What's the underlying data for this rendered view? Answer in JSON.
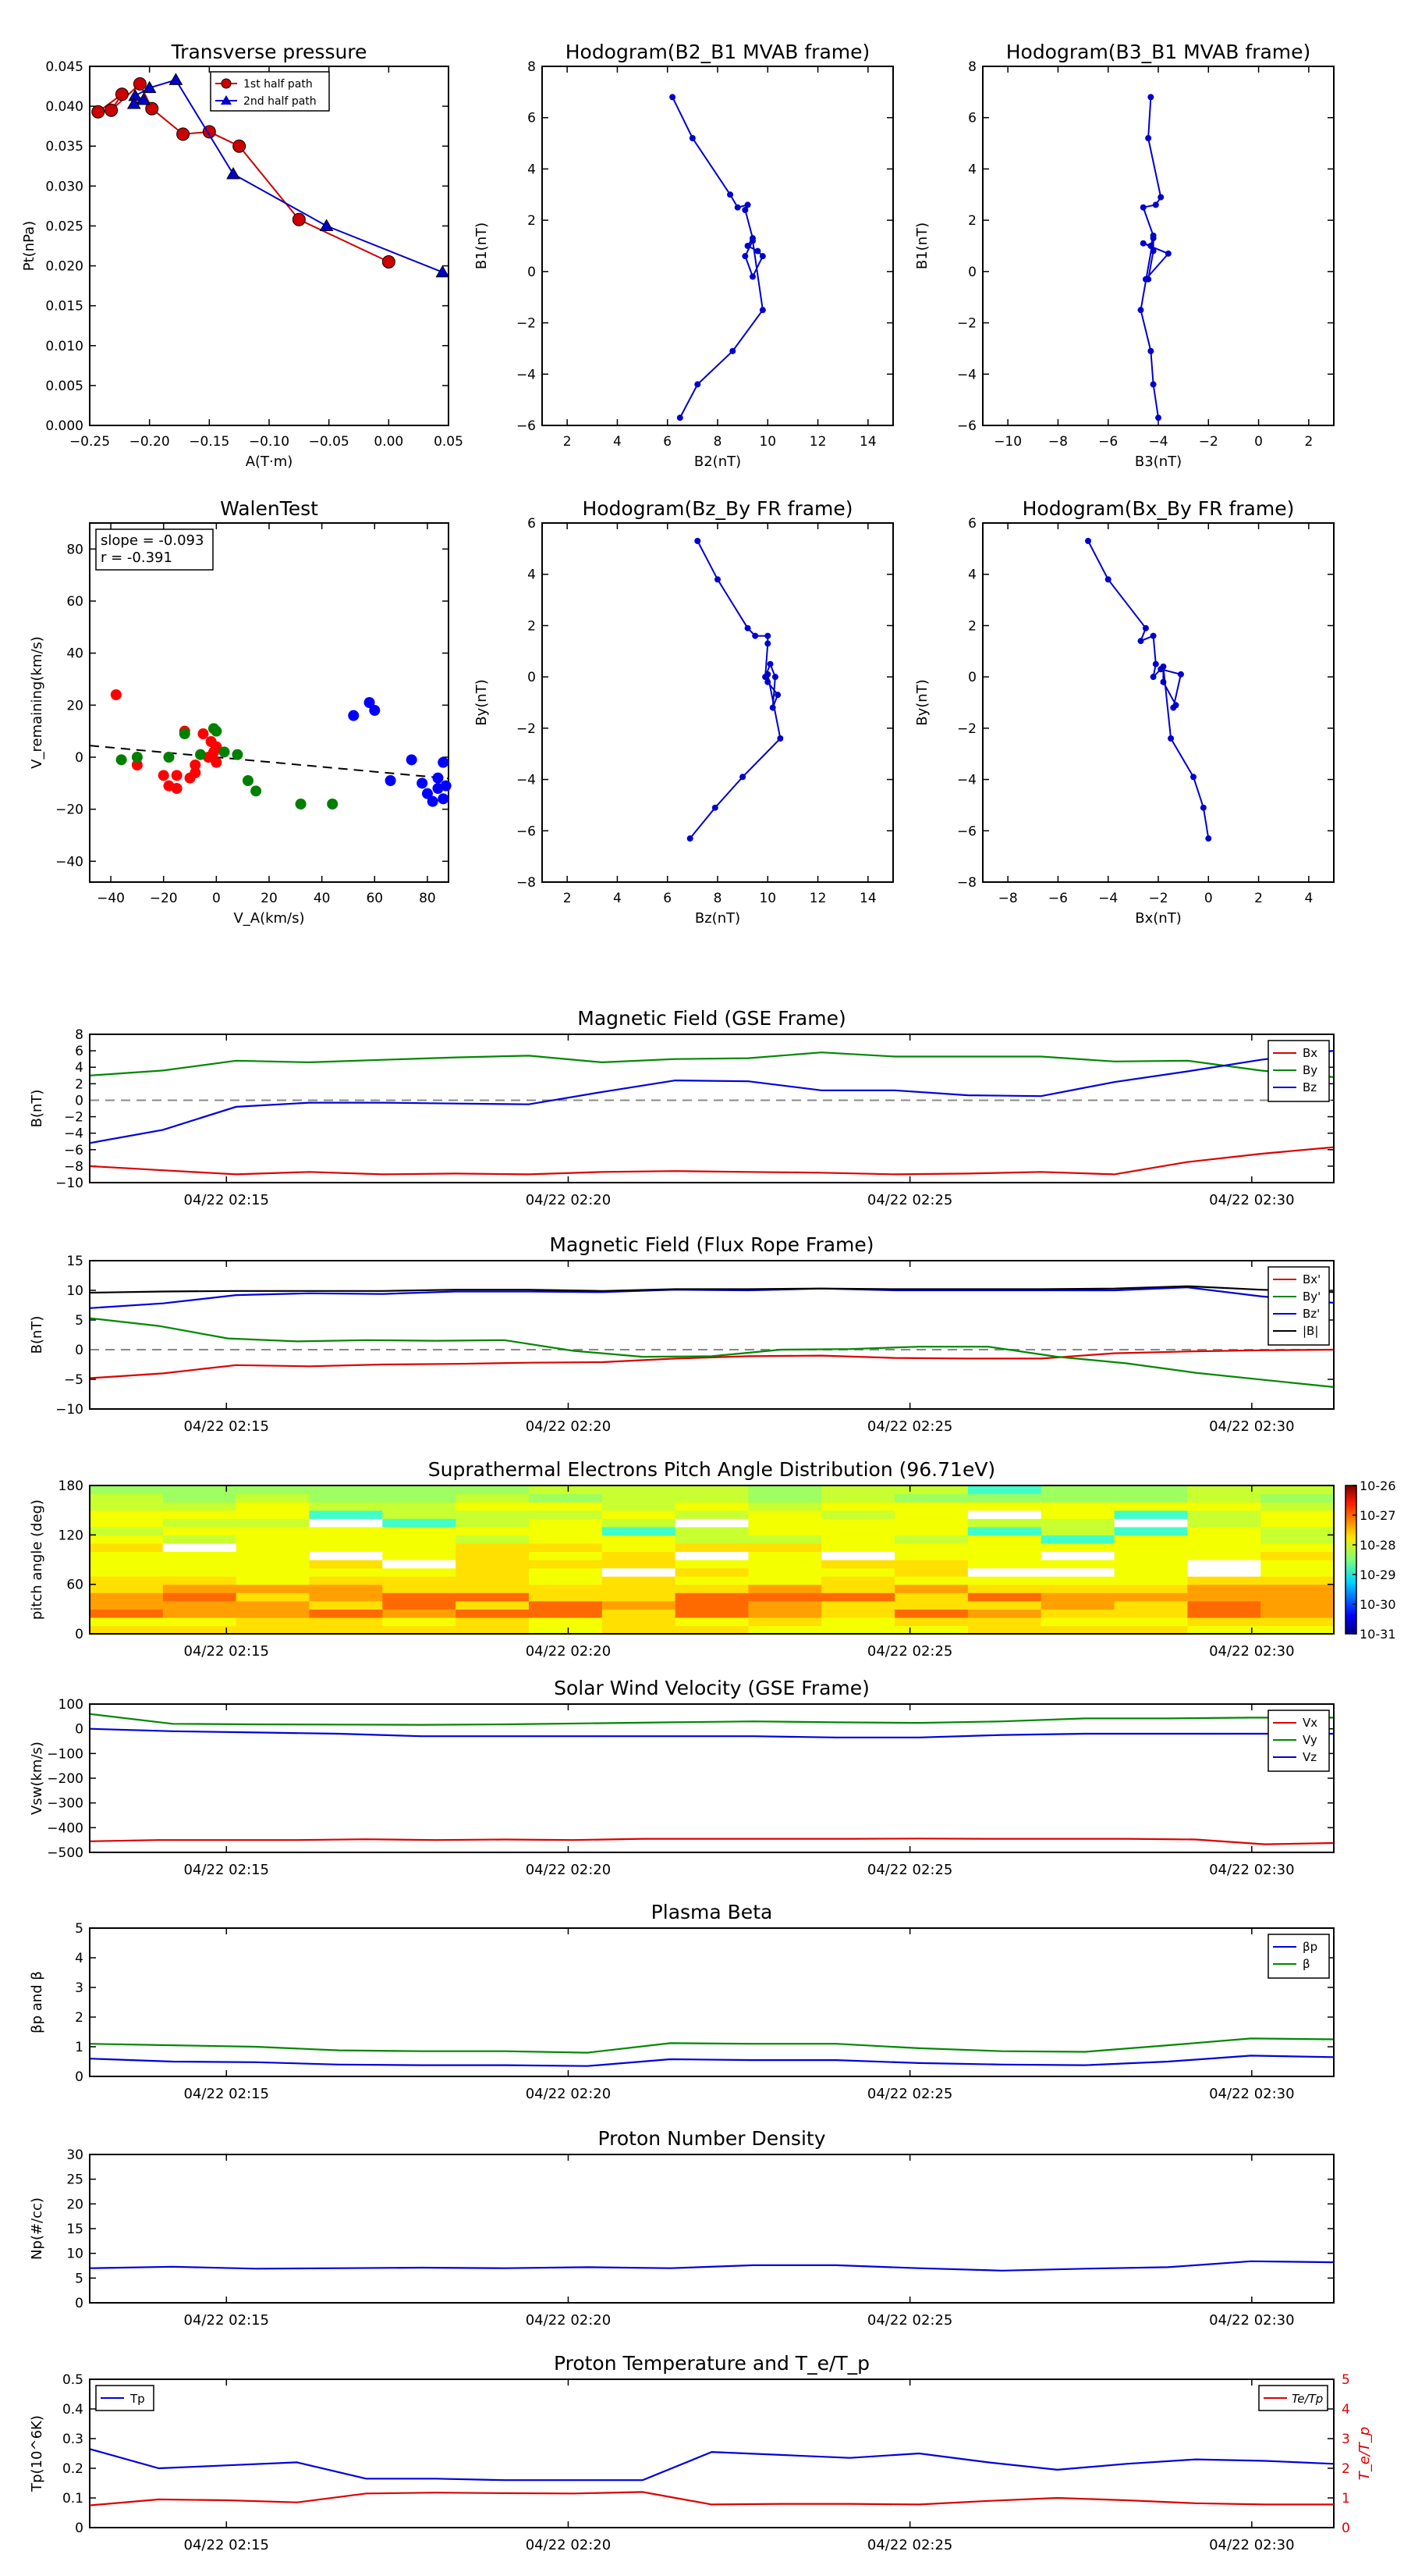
{
  "chart_data": [
    {
      "id": "tp",
      "type": "line",
      "title": "Transverse pressure",
      "xlabel": "A(T·m)",
      "ylabel": "Pt(nPa)",
      "xlim": [
        -0.25,
        0.05
      ],
      "ylim": [
        0.0,
        0.045
      ],
      "xticks": [
        -0.25,
        -0.2,
        -0.15,
        -0.1,
        -0.05,
        0.0,
        0.05
      ],
      "xtick_labels": [
        "−0.25",
        "−0.20",
        "−0.15",
        "−0.10",
        "−0.05",
        "0.00",
        "0.05"
      ],
      "yticks": [
        0.0,
        0.005,
        0.01,
        0.015,
        0.02,
        0.025,
        0.03,
        0.035,
        0.04,
        0.045
      ],
      "ytick_labels": [
        "0.000",
        "0.005",
        "0.010",
        "0.015",
        "0.020",
        "0.025",
        "0.030",
        "0.035",
        "0.040",
        "0.045"
      ],
      "legend": {
        "placement": "top-center"
      },
      "series": [
        {
          "name": "1st half path",
          "color": "#cc0000",
          "marker": "circle",
          "x": [
            0.0,
            -0.075,
            -0.125,
            -0.15,
            -0.172,
            -0.198,
            -0.208,
            -0.232,
            -0.223,
            -0.243
          ],
          "y": [
            0.0205,
            0.0258,
            0.035,
            0.0368,
            0.0365,
            0.0397,
            0.0428,
            0.0395,
            0.0415,
            0.0393
          ]
        },
        {
          "name": "2nd half path",
          "color": "#0000cc",
          "marker": "triangle",
          "x": [
            0.045,
            -0.052,
            -0.13,
            -0.178,
            -0.2,
            -0.212,
            -0.205,
            -0.213
          ],
          "y": [
            0.0192,
            0.025,
            0.0315,
            0.0433,
            0.0423,
            0.0413,
            0.0408,
            0.0403
          ]
        }
      ]
    },
    {
      "id": "h1",
      "type": "line",
      "title": "Hodogram(B2_B1 MVAB frame)",
      "xlabel": "B2(nT)",
      "ylabel": "B1(nT)",
      "xlim": [
        1,
        15
      ],
      "ylim": [
        -6,
        8
      ],
      "xticks": [
        2,
        4,
        6,
        8,
        10,
        12,
        14
      ],
      "yticks": [
        -6,
        -4,
        -2,
        0,
        2,
        4,
        6,
        8
      ],
      "color": "#0000cc",
      "series": [
        {
          "x": [
            6.2,
            7.0,
            8.5,
            8.8,
            9.2,
            9.1,
            9.4,
            9.2,
            9.6,
            9.8,
            9.4,
            9.1,
            9.4,
            9.8,
            8.6,
            7.2,
            6.5
          ],
          "y": [
            6.8,
            5.2,
            3.0,
            2.5,
            2.6,
            2.4,
            1.3,
            1.0,
            0.8,
            0.6,
            -0.2,
            0.6,
            1.2,
            -1.5,
            -3.1,
            -4.4,
            -5.7
          ]
        }
      ]
    },
    {
      "id": "h2",
      "type": "line",
      "title": "Hodogram(B3_B1 MVAB frame)",
      "xlabel": "B3(nT)",
      "ylabel": "B1(nT)",
      "xlim": [
        -11,
        3
      ],
      "ylim": [
        -6,
        8
      ],
      "xticks": [
        -10,
        -8,
        -6,
        -4,
        -2,
        0,
        2
      ],
      "yticks": [
        -6,
        -4,
        -2,
        0,
        2,
        4,
        6,
        8
      ],
      "color": "#0000cc",
      "series": [
        {
          "x": [
            -4.3,
            -4.4,
            -3.9,
            -4.1,
            -4.6,
            -4.2,
            -4.3,
            -4.6,
            -3.6,
            -4.5,
            -4.4,
            -4.2,
            -4.2,
            -4.7,
            -4.3,
            -4.2,
            -4.0
          ],
          "y": [
            6.8,
            5.2,
            2.9,
            2.6,
            2.5,
            1.4,
            1.0,
            1.1,
            0.7,
            -0.3,
            -0.3,
            0.8,
            1.3,
            -1.5,
            -3.1,
            -4.4,
            -5.7
          ]
        }
      ]
    },
    {
      "id": "walen",
      "type": "scatter",
      "title": "WalenTest",
      "xlabel": "V_A(km/s)",
      "ylabel": "V_remaining(km/s)",
      "xlim": [
        -48,
        88
      ],
      "ylim": [
        -48,
        90
      ],
      "xticks": [
        -40,
        -20,
        0,
        20,
        40,
        60,
        80
      ],
      "yticks": [
        -40,
        -20,
        0,
        20,
        40,
        60,
        80
      ],
      "annotation": [
        "slope = -0.093",
        "r = -0.391"
      ],
      "fit": {
        "slope": -0.093,
        "x": [
          -48,
          88
        ]
      },
      "series": [
        {
          "color": "#ff0000",
          "x": [
            -38,
            -30,
            -20,
            -18,
            -15,
            -15,
            -12,
            -10,
            -8,
            -8,
            -5,
            -3,
            -2,
            -1,
            0,
            0
          ],
          "y": [
            24,
            -3,
            -7,
            -11,
            -12,
            -7,
            10,
            -8,
            -6,
            -3,
            9,
            0,
            6,
            2,
            4,
            -2
          ]
        },
        {
          "color": "#008000",
          "x": [
            -36,
            -30,
            -18,
            -12,
            -6,
            -1,
            0,
            3,
            8,
            15,
            12,
            32,
            44
          ],
          "y": [
            -1,
            0,
            0,
            9,
            1,
            11,
            10,
            2,
            1,
            -13,
            -9,
            -18,
            -18
          ]
        },
        {
          "color": "#0000ff",
          "x": [
            52,
            58,
            60,
            66,
            74,
            78,
            80,
            82,
            84,
            84,
            86,
            87,
            86
          ],
          "y": [
            16,
            21,
            18,
            -9,
            -1,
            -10,
            -14,
            -17,
            -12,
            -8,
            -2,
            -11,
            -16
          ]
        }
      ]
    },
    {
      "id": "h3",
      "type": "line",
      "title": "Hodogram(Bz_By FR frame)",
      "xlabel": "Bz(nT)",
      "ylabel": "By(nT)",
      "xlim": [
        1,
        15
      ],
      "ylim": [
        -8,
        6
      ],
      "xticks": [
        2,
        4,
        6,
        8,
        10,
        12,
        14
      ],
      "yticks": [
        -8,
        -6,
        -4,
        -2,
        0,
        2,
        4,
        6
      ],
      "color": "#0000cc",
      "series": [
        {
          "x": [
            7.2,
            8.0,
            9.2,
            9.5,
            10.0,
            10.0,
            9.9,
            10.1,
            10.3,
            10.2,
            10.4,
            10.0,
            10.0,
            10.5,
            9.0,
            7.9,
            6.9
          ],
          "y": [
            5.3,
            3.8,
            1.9,
            1.6,
            1.6,
            1.3,
            0.0,
            0.5,
            0.0,
            -1.2,
            -0.7,
            -0.2,
            0.1,
            -2.4,
            -3.9,
            -5.1,
            -6.3
          ]
        }
      ]
    },
    {
      "id": "h4",
      "type": "line",
      "title": "Hodogram(Bx_By FR frame)",
      "xlabel": "Bx(nT)",
      "ylabel": "By(nT)",
      "xlim": [
        -9,
        5
      ],
      "ylim": [
        -8,
        6
      ],
      "xticks": [
        -8,
        -6,
        -4,
        -2,
        0,
        2,
        4
      ],
      "yticks": [
        -8,
        -6,
        -4,
        -2,
        0,
        2,
        4,
        6
      ],
      "color": "#0000cc",
      "series": [
        {
          "x": [
            -4.8,
            -4.0,
            -2.5,
            -2.7,
            -2.2,
            -2.1,
            -2.2,
            -1.9,
            -1.1,
            -1.4,
            -1.3,
            -1.8,
            -1.8,
            -1.5,
            -0.6,
            -0.2,
            0.0
          ],
          "y": [
            5.3,
            3.8,
            1.9,
            1.4,
            1.6,
            0.5,
            0.0,
            0.3,
            0.1,
            -1.2,
            -1.1,
            -0.2,
            0.4,
            -2.4,
            -3.9,
            -5.1,
            -6.3
          ]
        }
      ]
    },
    {
      "id": "mag_gse",
      "type": "line",
      "title": "Magnetic Field (GSE Frame)",
      "ylabel": "B(nT)",
      "ylim": [
        -10,
        8
      ],
      "yticks": [
        -10,
        -8,
        -6,
        -4,
        -2,
        0,
        2,
        4,
        6,
        8
      ],
      "legend": {
        "placement": "top-right"
      },
      "series": [
        {
          "name": "Bx",
          "color": "#dd0000",
          "values": [
            -8,
            -8.5,
            -9,
            -8.7,
            -9,
            -8.9,
            -9,
            -8.7,
            -8.6,
            -8.7,
            -8.8,
            -9,
            -8.9,
            -8.7,
            -9,
            -7.5,
            -6.5,
            -5.7
          ]
        },
        {
          "name": "By",
          "color": "#008800",
          "values": [
            3,
            3.6,
            4.8,
            4.6,
            4.9,
            5.2,
            5.4,
            4.6,
            5,
            5.1,
            5.8,
            5.3,
            5.3,
            5.3,
            4.7,
            4.8,
            3.6,
            2.8
          ]
        },
        {
          "name": "Bz",
          "color": "#0000dd",
          "values": [
            -5.2,
            -3.6,
            -0.8,
            -0.3,
            -0.3,
            -0.4,
            -0.5,
            1,
            2.4,
            2.3,
            1.2,
            1.2,
            0.6,
            0.5,
            2.2,
            3.5,
            4.9,
            6
          ]
        }
      ]
    },
    {
      "id": "mag_fr",
      "type": "line",
      "title": "Magnetic Field (Flux Rope Frame)",
      "ylabel": "B(nT)",
      "ylim": [
        -10,
        15
      ],
      "yticks": [
        -10,
        -5,
        0,
        5,
        10,
        15
      ],
      "legend": {
        "placement": "top-right"
      },
      "series": [
        {
          "name": "Bx'",
          "color": "#dd0000",
          "values": [
            -4.8,
            -4,
            -2.6,
            -2.8,
            -2.5,
            -2.4,
            -2.2,
            -2.1,
            -1.5,
            -1.1,
            -1,
            -1.4,
            -1.5,
            -1.5,
            -0.6,
            -0.3,
            -0.1,
            0
          ]
        },
        {
          "name": "By'",
          "color": "#008800",
          "values": [
            5.3,
            4,
            1.9,
            1.4,
            1.6,
            1.5,
            1.6,
            -0.2,
            -1.2,
            -1.1,
            0,
            0.1,
            0.5,
            0.5,
            -1.2,
            -2.3,
            -3.9,
            -5.1,
            -6.3
          ]
        },
        {
          "name": "Bz'",
          "color": "#0000dd",
          "values": [
            7,
            7.8,
            9.2,
            9.5,
            9.4,
            9.8,
            9.8,
            9.7,
            10.1,
            10,
            10.3,
            10,
            10,
            10,
            10,
            10.5,
            9,
            7.9
          ]
        },
        {
          "name": "|B|",
          "color": "#000000",
          "values": [
            9.6,
            9.8,
            9.9,
            9.9,
            9.9,
            10.1,
            10.1,
            9.9,
            10.2,
            10.2,
            10.3,
            10.2,
            10.2,
            10.2,
            10.3,
            10.7,
            10.1,
            9.7
          ]
        }
      ]
    },
    {
      "id": "pad",
      "type": "heatmap",
      "title": "Suprathermal Electrons Pitch Angle Distribution (96.71eV)",
      "ylabel": "pitch angle (deg)",
      "ylim": [
        0,
        180
      ],
      "yticks": [
        0,
        60,
        120,
        180
      ],
      "colorbar": {
        "ticks": [
          "10-26",
          "10-27",
          "10-28",
          "10-29",
          "10-30",
          "10-31"
        ],
        "scale": "log"
      }
    },
    {
      "id": "vsw",
      "type": "line",
      "title": "Solar Wind Velocity (GSE Frame)",
      "ylabel": "Vsw(km/s)",
      "ylim": [
        -500,
        100
      ],
      "yticks": [
        -500,
        -400,
        -300,
        -200,
        -100,
        0,
        100
      ],
      "legend": {
        "placement": "top-right"
      },
      "series": [
        {
          "name": "Vx",
          "color": "#dd0000",
          "values": [
            -455,
            -450,
            -450,
            -450,
            -447,
            -450,
            -448,
            -450,
            -445,
            -445,
            -445,
            -445,
            -444,
            -445,
            -445,
            -445,
            -448,
            -467,
            -462
          ]
        },
        {
          "name": "Vy",
          "color": "#008800",
          "values": [
            60,
            20,
            18,
            17,
            16,
            18,
            22,
            26,
            30,
            26,
            24,
            30,
            42,
            42,
            45,
            45
          ]
        },
        {
          "name": "Vz",
          "color": "#0000dd",
          "values": [
            0,
            -10,
            -15,
            -20,
            -30,
            -30,
            -30,
            -30,
            -30,
            -35,
            -35,
            -25,
            -20,
            -20,
            -20,
            -20
          ]
        }
      ]
    },
    {
      "id": "beta",
      "type": "line",
      "title": "Plasma Beta",
      "ylabel": "βp and β",
      "ylim": [
        0,
        5
      ],
      "yticks": [
        0,
        1,
        2,
        3,
        4,
        5
      ],
      "legend": {
        "placement": "top-right"
      },
      "series": [
        {
          "name": "βp",
          "color": "#0000dd",
          "values": [
            0.6,
            0.5,
            0.48,
            0.4,
            0.38,
            0.38,
            0.35,
            0.58,
            0.55,
            0.55,
            0.45,
            0.4,
            0.38,
            0.5,
            0.7,
            0.65
          ]
        },
        {
          "name": "β",
          "color": "#008800",
          "values": [
            1.1,
            1.05,
            1.0,
            0.88,
            0.85,
            0.85,
            0.8,
            1.12,
            1.1,
            1.1,
            0.95,
            0.85,
            0.83,
            1.05,
            1.28,
            1.25
          ]
        }
      ]
    },
    {
      "id": "np",
      "type": "line",
      "title": "Proton Number Density",
      "ylabel": "Np(#/cc)",
      "ylim": [
        0,
        30
      ],
      "yticks": [
        0,
        5,
        10,
        15,
        20,
        25,
        30
      ],
      "series": [
        {
          "color": "#0000dd",
          "values": [
            7.0,
            7.3,
            6.9,
            7.0,
            7.1,
            7.0,
            7.2,
            7.0,
            7.6,
            7.6,
            7.0,
            6.5,
            6.9,
            7.2,
            8.4,
            8.2
          ]
        }
      ]
    },
    {
      "id": "tp_temp",
      "type": "line",
      "title": "Proton Temperature and T_e/T_p",
      "ylabel": "Tp(10^6K)",
      "ylabel_right": "T_e/T_p",
      "ylim": [
        0,
        0.5
      ],
      "ylim_right": [
        0,
        5
      ],
      "yticks": [
        0,
        0.1,
        0.2,
        0.3,
        0.4,
        0.5
      ],
      "yticks_right": [
        0,
        1,
        2,
        3,
        4,
        5
      ],
      "legend_left": {
        "placement": "top-left"
      },
      "legend_right": {
        "placement": "top-right"
      },
      "series": [
        {
          "name": "Tp",
          "color": "#0000dd",
          "axis": "left",
          "values": [
            0.265,
            0.2,
            0.21,
            0.22,
            0.165,
            0.165,
            0.16,
            0.16,
            0.16,
            0.255,
            0.245,
            0.235,
            0.25,
            0.22,
            0.195,
            0.215,
            0.23,
            0.225,
            0.215
          ]
        },
        {
          "name": "Te/Tp",
          "color": "#dd0000",
          "axis": "right",
          "values": [
            0.75,
            0.95,
            0.92,
            0.85,
            1.15,
            1.18,
            1.16,
            1.15,
            1.2,
            0.78,
            0.8,
            0.8,
            0.78,
            0.9,
            1.0,
            0.92,
            0.82,
            0.78,
            0.78
          ]
        }
      ]
    }
  ],
  "time_axis": {
    "tick_labels": [
      "04/22 02:15",
      "04/22 02:20",
      "04/22 02:25",
      "04/22 02:30"
    ],
    "tick_minutes": [
      15,
      20,
      25,
      30
    ],
    "xlim_minutes": [
      13,
      31.2
    ]
  }
}
